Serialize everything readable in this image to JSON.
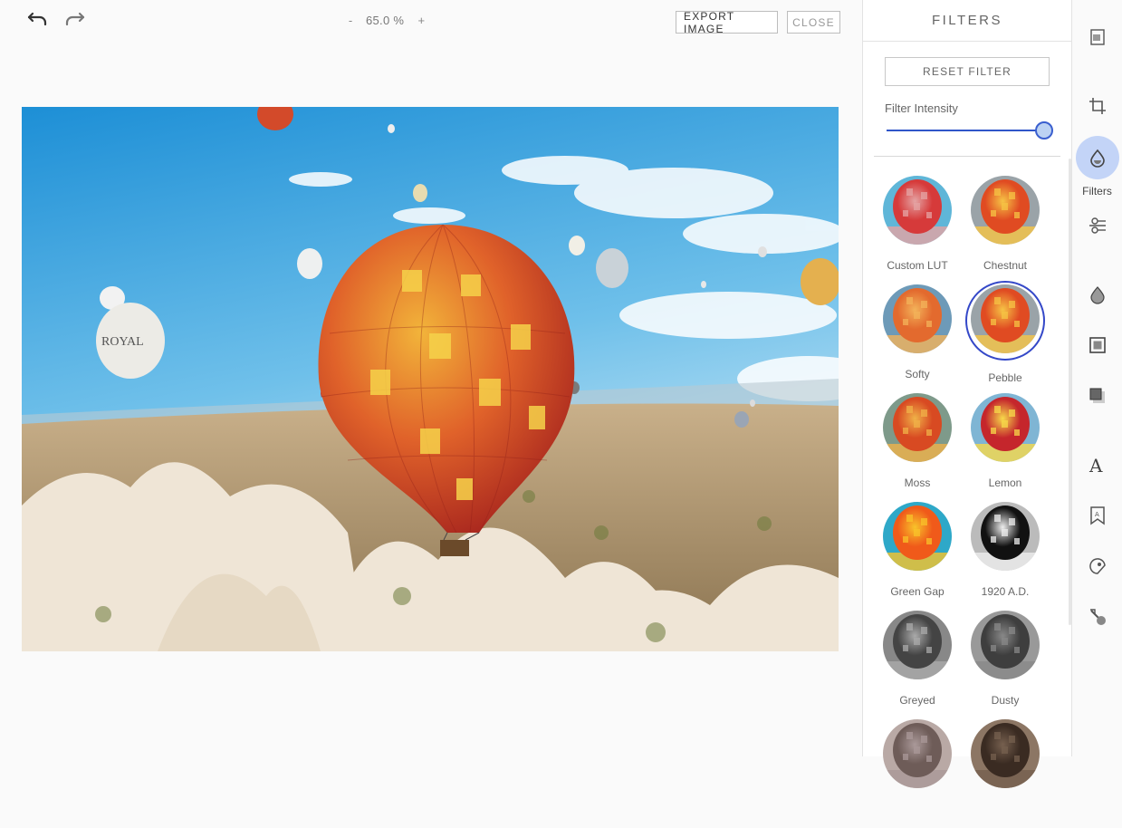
{
  "toolbar": {
    "undo_icon": "undo-icon",
    "redo_icon": "redo-icon",
    "zoom_minus": "-",
    "zoom_value": "65.0 %",
    "zoom_plus": "+",
    "export_label": "EXPORT IMAGE",
    "close_label": "CLOSE"
  },
  "panel": {
    "title": "FILTERS",
    "reset_label": "RESET FILTER",
    "intensity_label": "Filter Intensity",
    "intensity_value": 1.0,
    "filters": [
      {
        "label": "Custom LUT",
        "tone": "lut"
      },
      {
        "label": "Chestnut",
        "tone": "warm"
      },
      {
        "label": "Softy",
        "tone": "soft"
      },
      {
        "label": "Pebble",
        "tone": "warm",
        "selected": true
      },
      {
        "label": "Moss",
        "tone": "moss"
      },
      {
        "label": "Lemon",
        "tone": "lemon"
      },
      {
        "label": "Green Gap",
        "tone": "green"
      },
      {
        "label": "1920 A.D.",
        "tone": "bw"
      },
      {
        "label": "Greyed",
        "tone": "grey"
      },
      {
        "label": "Dusty",
        "tone": "dusty"
      },
      {
        "label": "",
        "tone": "sepia1"
      },
      {
        "label": "",
        "tone": "sepia2"
      }
    ]
  },
  "rail": {
    "active_label": "Filters",
    "icons": [
      "library-icon",
      "crop-icon",
      "filters-icon",
      "adjust-icon",
      "focus-icon",
      "frame-icon",
      "overlay-icon",
      "text-icon",
      "sticker-icon",
      "brush-icon",
      "eraser-icon"
    ]
  },
  "colors": {
    "accent": "#2f55c9",
    "selected_ring": "#3448c8",
    "active_bubble": "#c3d4f7"
  }
}
